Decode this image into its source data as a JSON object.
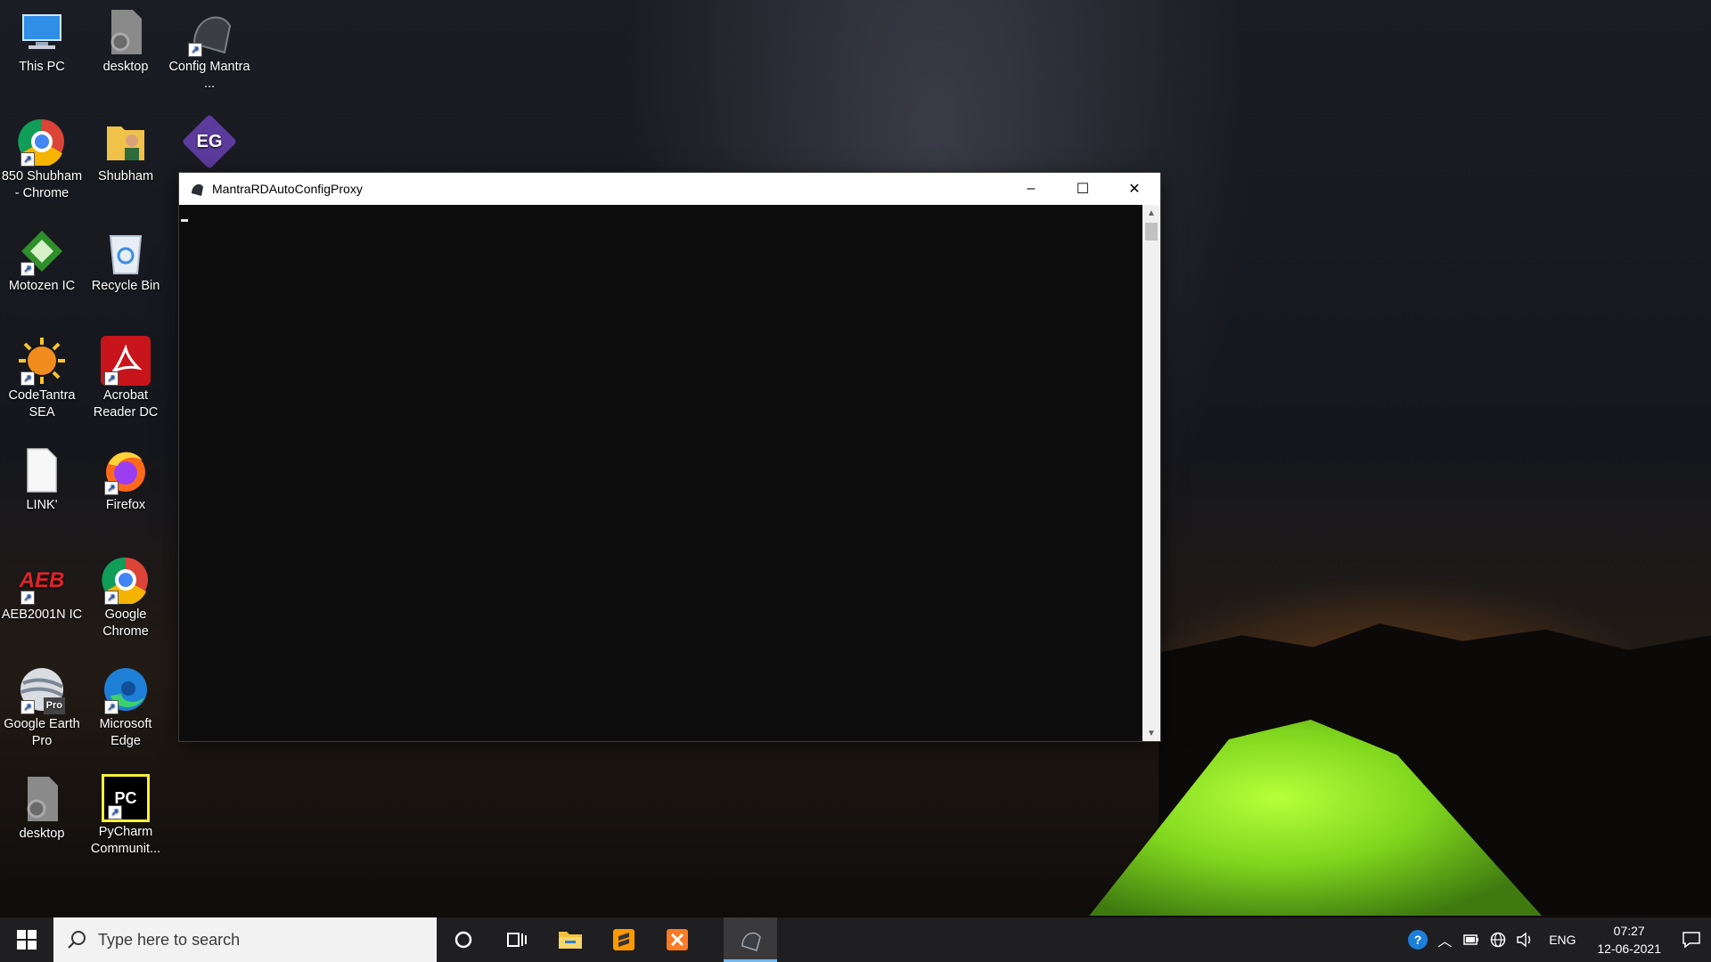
{
  "desktop": {
    "icons": [
      {
        "name": "desktop-icon-this-pc",
        "label": "This PC",
        "icon": "monitor-icon"
      },
      {
        "name": "desktop-icon-desktop-1",
        "label": "desktop",
        "icon": "gear-file-icon"
      },
      {
        "name": "desktop-icon-config-mantra",
        "label": "Config Mantra ...",
        "icon": "mantra-device-icon"
      },
      {
        "name": "desktop-icon-850-shubham-chrome",
        "label": "850 Shubham - Chrome",
        "icon": "chrome-profile-icon"
      },
      {
        "name": "desktop-icon-shubham",
        "label": "Shubham",
        "icon": "user-folder-icon"
      },
      {
        "name": "desktop-icon-eg",
        "label": "",
        "icon": "eg-logo-icon"
      },
      {
        "name": "desktop-icon-motozen",
        "label": "Motozen IC",
        "icon": "motozen-icon"
      },
      {
        "name": "desktop-icon-recycle-bin",
        "label": "Recycle Bin",
        "icon": "recycle-bin-icon"
      },
      {
        "name": "desktop-icon-codetantra",
        "label": "CodeTantra SEA",
        "icon": "sun-icon"
      },
      {
        "name": "desktop-icon-acrobat",
        "label": "Acrobat Reader DC",
        "icon": "acrobat-icon"
      },
      {
        "name": "desktop-icon-link",
        "label": "LINK'",
        "icon": "blank-file-icon"
      },
      {
        "name": "desktop-icon-firefox",
        "label": "Firefox",
        "icon": "firefox-icon"
      },
      {
        "name": "desktop-icon-aeb2001n",
        "label": "AEB2001N IC",
        "icon": "aeb-icon"
      },
      {
        "name": "desktop-icon-google-chrome",
        "label": "Google Chrome",
        "icon": "chrome-icon"
      },
      {
        "name": "desktop-icon-google-earth",
        "label": "Google Earth Pro",
        "icon": "google-earth-icon"
      },
      {
        "name": "desktop-icon-edge",
        "label": "Microsoft Edge",
        "icon": "edge-icon"
      },
      {
        "name": "desktop-icon-desktop-2",
        "label": "desktop",
        "icon": "gear-file-icon"
      },
      {
        "name": "desktop-icon-pycharm",
        "label": "PyCharm Communit...",
        "icon": "pycharm-icon"
      }
    ],
    "google_earth_badge": "Pro",
    "eg_text": "EG",
    "pycharm_text": "PC",
    "aeb_text": "AEB"
  },
  "window": {
    "title": "MantraRDAutoConfigProxy",
    "minimize_label": "–",
    "maximize_label": "☐",
    "close_label": "✕"
  },
  "taskbar": {
    "search_placeholder": "Type here to search",
    "tray": {
      "language": "ENG",
      "time": "07:27",
      "date": "12-06-2021"
    }
  },
  "colors": {
    "accent": "#76b9ed",
    "taskbar": "#1f1f21",
    "console_bg": "#0c0c0c"
  }
}
